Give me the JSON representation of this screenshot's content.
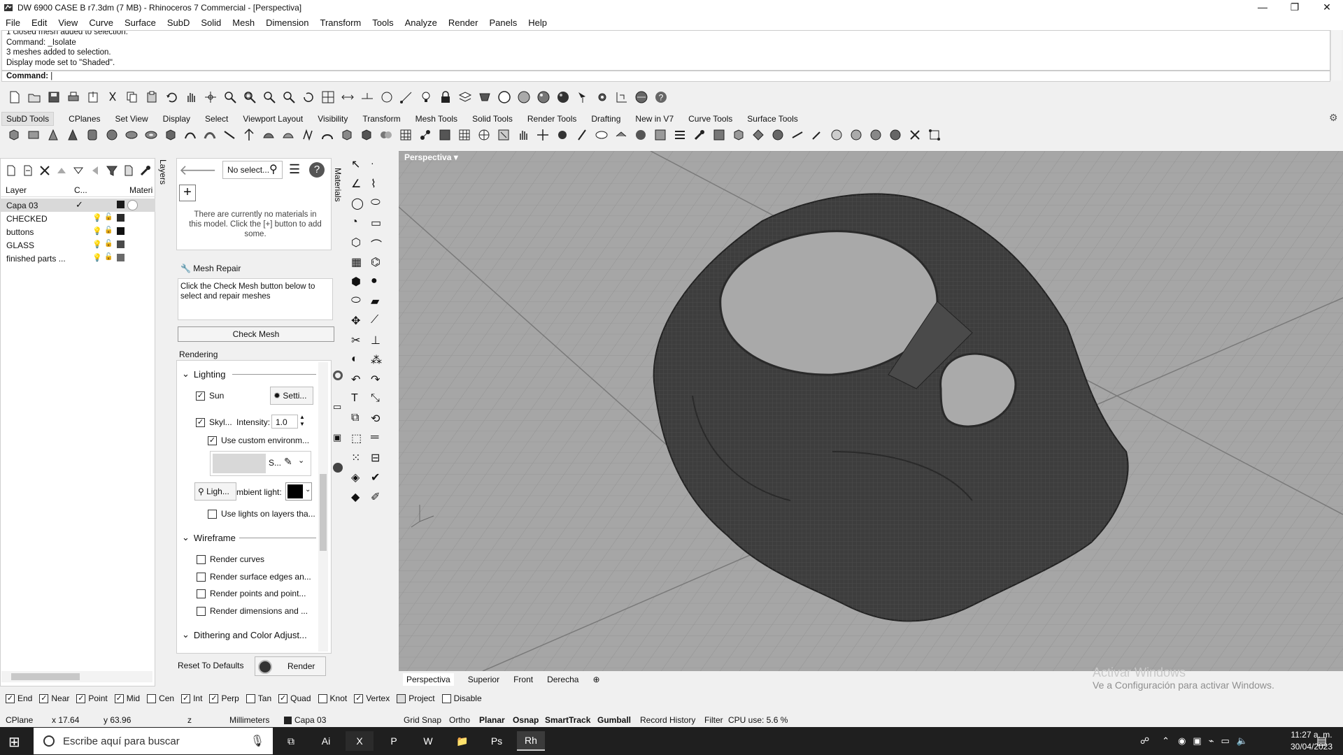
{
  "window": {
    "title": "DW 6900 CASE B r7.3dm (7 MB) - Rhinoceros 7 Commercial - [Perspectiva]",
    "minimize": "—",
    "maximize": "❐",
    "close": "✕"
  },
  "menu": [
    "File",
    "Edit",
    "View",
    "Curve",
    "Surface",
    "SubD",
    "Solid",
    "Mesh",
    "Dimension",
    "Transform",
    "Tools",
    "Analyze",
    "Render",
    "Panels",
    "Help"
  ],
  "command_history": [
    "1 closed mesh added to selection.",
    "Command: _Isolate",
    "3 meshes added to selection.",
    "Display mode set to \"Shaded\"."
  ],
  "command_prompt": "Command:",
  "toolbar_tabs": [
    "SubD Tools",
    "CPlanes",
    "Set View",
    "Display",
    "Select",
    "Viewport Layout",
    "Visibility",
    "Transform",
    "Mesh Tools",
    "Solid Tools",
    "Render Tools",
    "Drafting",
    "New in V7",
    "Curve Tools",
    "Surface Tools"
  ],
  "layers": {
    "headers": {
      "layer": "Layer",
      "current": "C...",
      "material": "Materi"
    },
    "rows": [
      {
        "name": "Capa 03",
        "selected": true,
        "current": true,
        "color": "#1a1a1a"
      },
      {
        "name": "CHECKED",
        "selected": false,
        "current": false,
        "color": "#2a2a2a"
      },
      {
        "name": "buttons",
        "selected": false,
        "current": false,
        "color": "#111111"
      },
      {
        "name": "GLASS",
        "selected": false,
        "current": false,
        "color": "#4a4a4a"
      },
      {
        "name": "finished parts ...",
        "selected": false,
        "current": false,
        "color": "#6a6a6a"
      }
    ],
    "side_tab": "Layers"
  },
  "materials": {
    "search_placeholder": "No select...",
    "empty_message": "There are currently no materials in this model. Click the [+] button to add some.",
    "side_tab": "Materials"
  },
  "mesh_repair": {
    "title": "Mesh Repair",
    "instructions": "Click the Check Mesh button below to select and repair meshes",
    "check_button": "Check Mesh"
  },
  "rendering": {
    "title": "Rendering",
    "lighting_section": "Lighting",
    "sun_label": "Sun",
    "sun_settings": "Setti...",
    "skylight_label": "Skyl...",
    "intensity_label": "Intensity:",
    "intensity_value": "1.0",
    "custom_env_label": "Use custom environm...",
    "env_short": "S...",
    "lights_label": "Ligh...",
    "ambient_label": "mbient light:",
    "ambient_color": "#000000",
    "use_lights_label": "Use lights on layers tha...",
    "wireframe_section": "Wireframe",
    "render_curves": "Render curves",
    "render_surface_edges": "Render surface edges an...",
    "render_points": "Render points and point...",
    "render_dimensions": "Render dimensions and ...",
    "dithering_section": "Dithering and Color Adjust...",
    "reset_button": "Reset To Defaults",
    "render_button": "Render"
  },
  "viewport": {
    "title": "Perspectiva",
    "tabs": [
      "Perspectiva",
      "Superior",
      "Front",
      "Derecha"
    ],
    "add_tab": "⊕",
    "activation_title": "Activar Windows",
    "activation_sub": "Ve a Configuración para activar Windows."
  },
  "osnaps": [
    {
      "label": "End",
      "checked": true
    },
    {
      "label": "Near",
      "checked": true
    },
    {
      "label": "Point",
      "checked": true
    },
    {
      "label": "Mid",
      "checked": true
    },
    {
      "label": "Cen",
      "checked": false
    },
    {
      "label": "Int",
      "checked": true
    },
    {
      "label": "Perp",
      "checked": true
    },
    {
      "label": "Tan",
      "checked": false
    },
    {
      "label": "Quad",
      "checked": true
    },
    {
      "label": "Knot",
      "checked": false
    },
    {
      "label": "Vertex",
      "checked": true
    },
    {
      "label": "Project",
      "checked": false
    },
    {
      "label": "Disable",
      "checked": false
    }
  ],
  "status": {
    "cplane": "CPlane",
    "x": "x 17.64",
    "y": "y 63.96",
    "z": "z",
    "units": "Millimeters",
    "layer": "Capa 03",
    "grid_snap": "Grid Snap",
    "ortho": "Ortho",
    "planar": "Planar",
    "osnap": "Osnap",
    "smarttrack": "SmartTrack",
    "gumball": "Gumball",
    "record_history": "Record History",
    "filter": "Filter",
    "cpu": "CPU use: 5.6 %"
  },
  "taskbar": {
    "search_placeholder": "Escribe aquí para buscar",
    "apps": [
      "Ai",
      "X",
      "P",
      "W",
      "📁",
      "Ps",
      "Rh"
    ],
    "time": "11:27 a. m.",
    "date": "30/04/2023"
  }
}
